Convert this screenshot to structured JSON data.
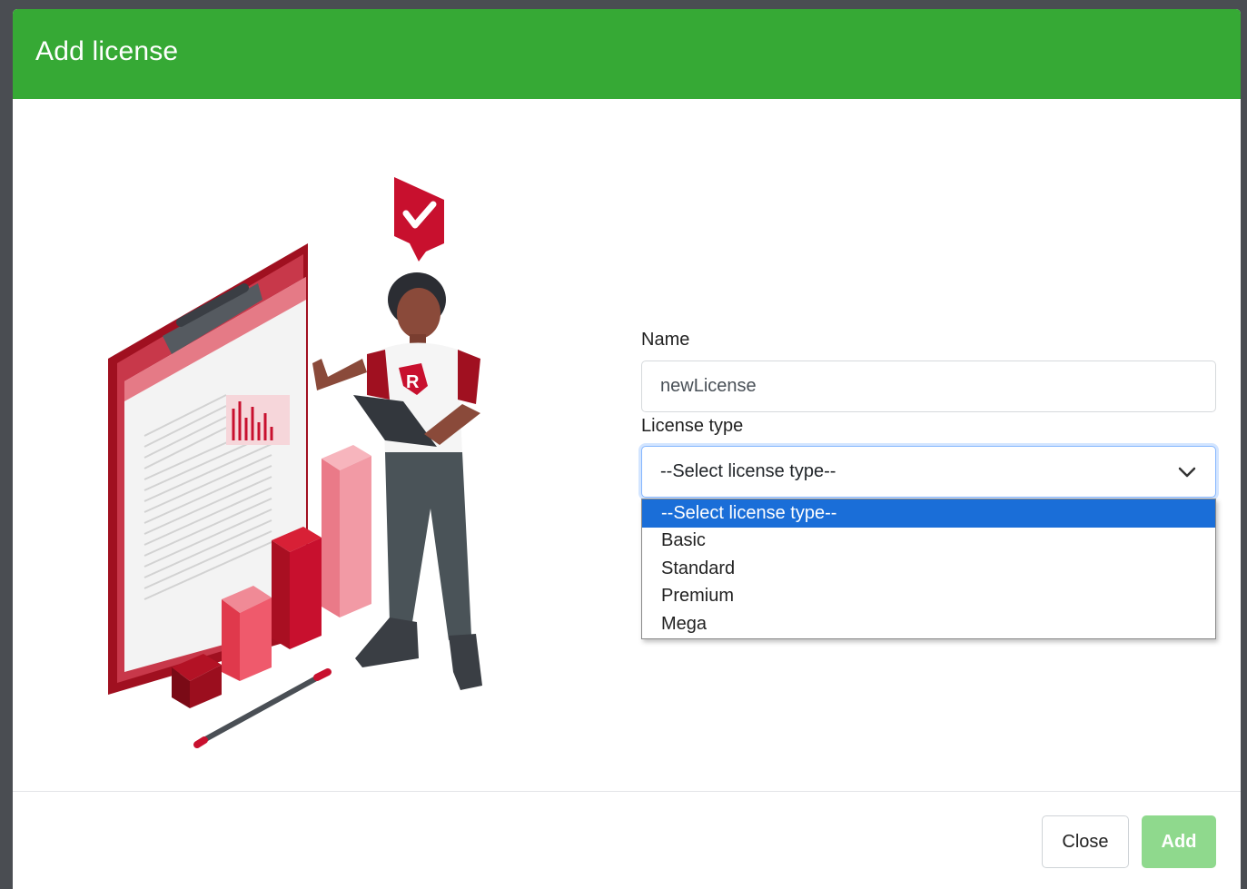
{
  "modal": {
    "title": "Add license",
    "header_color": "#36a935"
  },
  "form": {
    "name_label": "Name",
    "name_value": "newLicense",
    "license_type_label": "License type",
    "license_type_selected": "--Select license type--",
    "license_type_options": [
      "--Select license type--",
      "Basic",
      "Standard",
      "Premium",
      "Mega"
    ]
  },
  "footer": {
    "close_label": "Close",
    "add_label": "Add"
  },
  "illustration": {
    "badge_letter": "R",
    "accent_color": "#c8102e"
  }
}
